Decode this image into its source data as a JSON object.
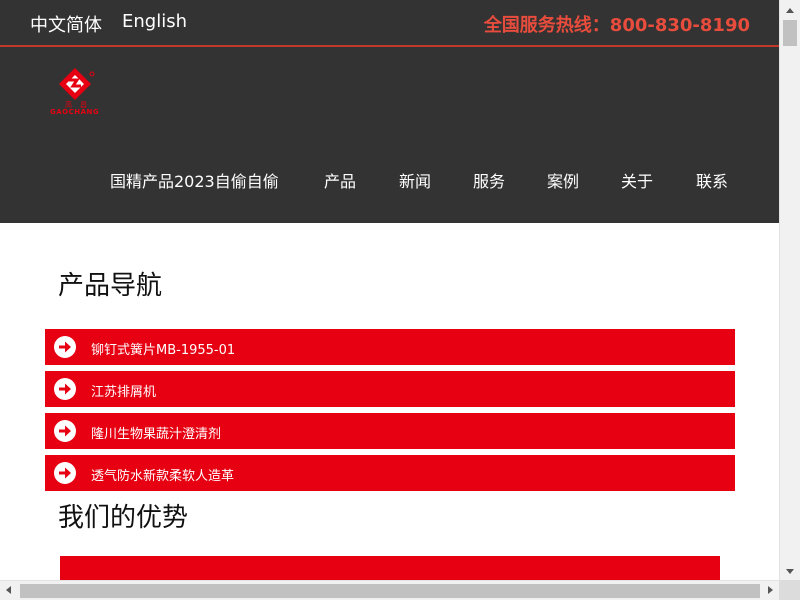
{
  "header": {
    "lang_zh": "中文简体",
    "lang_en": "English",
    "hotline": "全国服务热线：800-830-8190",
    "logo_text": "GAOCHANG",
    "nav": [
      {
        "label": "国精产品2023自偷自偷"
      },
      {
        "label": "产品"
      },
      {
        "label": "新闻"
      },
      {
        "label": "服务"
      },
      {
        "label": "案例"
      },
      {
        "label": "关于"
      },
      {
        "label": "联系"
      }
    ]
  },
  "products": {
    "title": "产品导航",
    "items": [
      {
        "label": "铆钉式簧片MB-1955-01",
        "icon": "arrow-right-circle-icon"
      },
      {
        "label": "江苏排屑机",
        "icon": "arrow-right-circle-icon"
      },
      {
        "label": "隆川生物果蔬汁澄清剂",
        "icon": "arrow-right-circle-icon"
      },
      {
        "label": "透气防水新款柔软人造革",
        "icon": "arrow-right-circle-icon"
      }
    ]
  },
  "advantages": {
    "title": "我们的优势"
  },
  "colors": {
    "header_bg": "#333333",
    "accent_red": "#e60012",
    "hotline_red": "#e74c3c",
    "divider": "#c0392b"
  }
}
